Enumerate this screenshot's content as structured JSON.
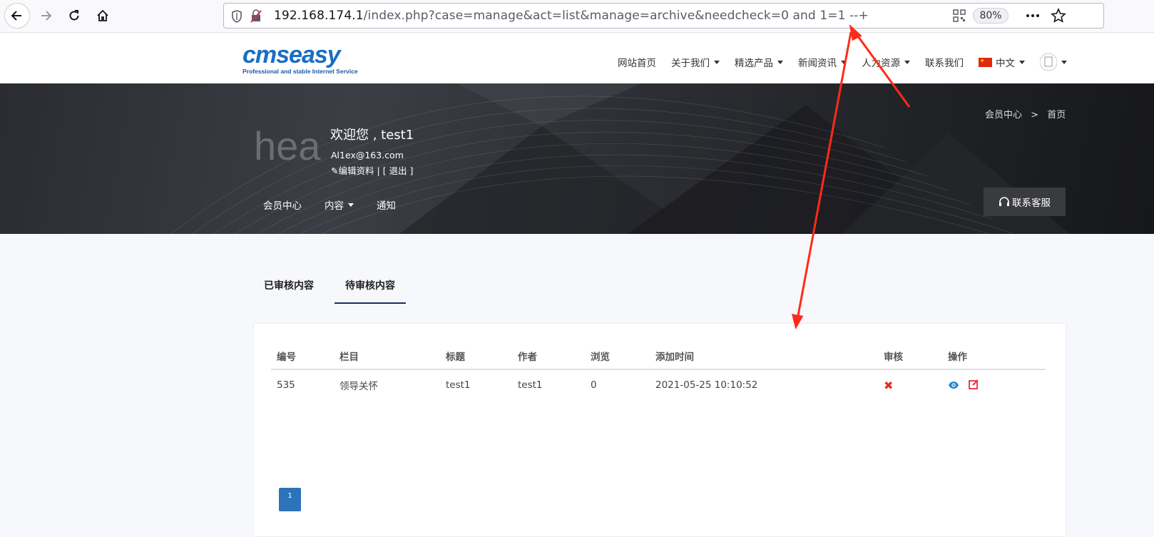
{
  "browser": {
    "url_host": "192.168.174.1",
    "url_rest": "/index.php?case=manage&act=list&manage=archive&needcheck=0 and 1=1 --+",
    "zoom": "80%"
  },
  "site": {
    "logo_text": "cmseasy",
    "logo_tagline": "Professional and stable Internet Service",
    "nav": [
      {
        "label": "网站首页",
        "dropdown": false
      },
      {
        "label": "关于我们",
        "dropdown": true
      },
      {
        "label": "精选产品",
        "dropdown": true
      },
      {
        "label": "新闻资讯",
        "dropdown": true
      },
      {
        "label": "人力资源",
        "dropdown": true
      },
      {
        "label": "联系我们",
        "dropdown": false
      }
    ],
    "language": "中文"
  },
  "member": {
    "avatar_text": "hea",
    "welcome": "欢迎您 , test1",
    "email": "Al1ex@163.com",
    "edit_profile": "编辑资料",
    "separator": "|",
    "logout": "[ 退出 ]",
    "breadcrumb": {
      "home": "会员中心",
      "sep": ">",
      "current": "首页"
    },
    "nav": [
      {
        "label": "会员中心",
        "dropdown": false
      },
      {
        "label": "内容",
        "dropdown": true
      },
      {
        "label": "通知",
        "dropdown": false
      }
    ],
    "support_label": "联系客服"
  },
  "tabs": [
    {
      "label": "已审核内容",
      "active": false
    },
    {
      "label": "待审核内容",
      "active": true
    }
  ],
  "table": {
    "headers": [
      "编号",
      "栏目",
      "标题",
      "作者",
      "浏览",
      "添加时间",
      "审核",
      "操作"
    ],
    "rows": [
      {
        "id": "535",
        "category": "领导关怀",
        "title": "test1",
        "author": "test1",
        "views": "0",
        "added": "2021-05-25 10:10:52",
        "approved": false
      }
    ]
  },
  "pagination": {
    "current": "1"
  },
  "colors": {
    "accent": "#2d73b8",
    "annotation": "#ff2a1a",
    "reject": "#e0302a"
  }
}
